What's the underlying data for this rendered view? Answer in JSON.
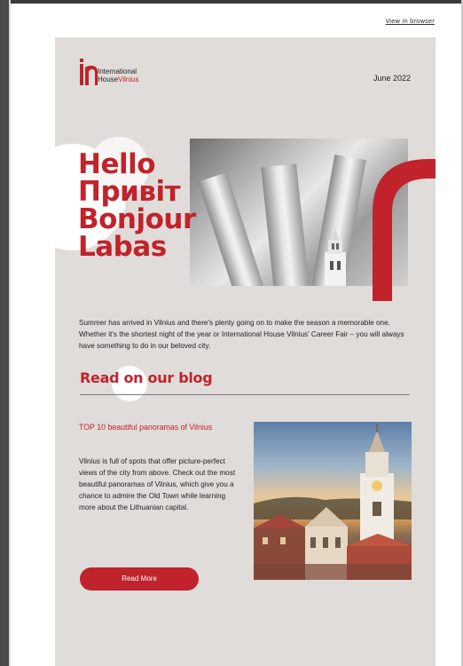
{
  "header": {
    "view_in_browser": "View in browser"
  },
  "logo": {
    "line1": "International",
    "line2_a": "House",
    "line2_b": "Vilnius"
  },
  "date": "June 2022",
  "hero": {
    "words": [
      "Hello",
      "Привіт",
      "Bonjour",
      "Labas"
    ]
  },
  "intro": "Summer has arrived in Vilnius and there's plenty going on to make the season a memorable one. Whether it's the shortest night of the year or International House Vilnius' Career Fair – you will always have something to do in our beloved city.",
  "blog": {
    "heading": "Read on our blog",
    "article": {
      "title": "TOP 10 beautiful panoramas of Vilnius",
      "body": "Vilnius is full of spots that offer picture-perfect views of the city from above. Check out the most beautiful panoramas of Vilnius, which give you a chance to admire the Old Town while learning more about the Lithuanian capital.",
      "button": "Read More"
    }
  },
  "colors": {
    "brand_red": "#c0232c",
    "card_bg": "#e0dcd9"
  },
  "icons": {
    "logo": "ih-logo-mark"
  }
}
